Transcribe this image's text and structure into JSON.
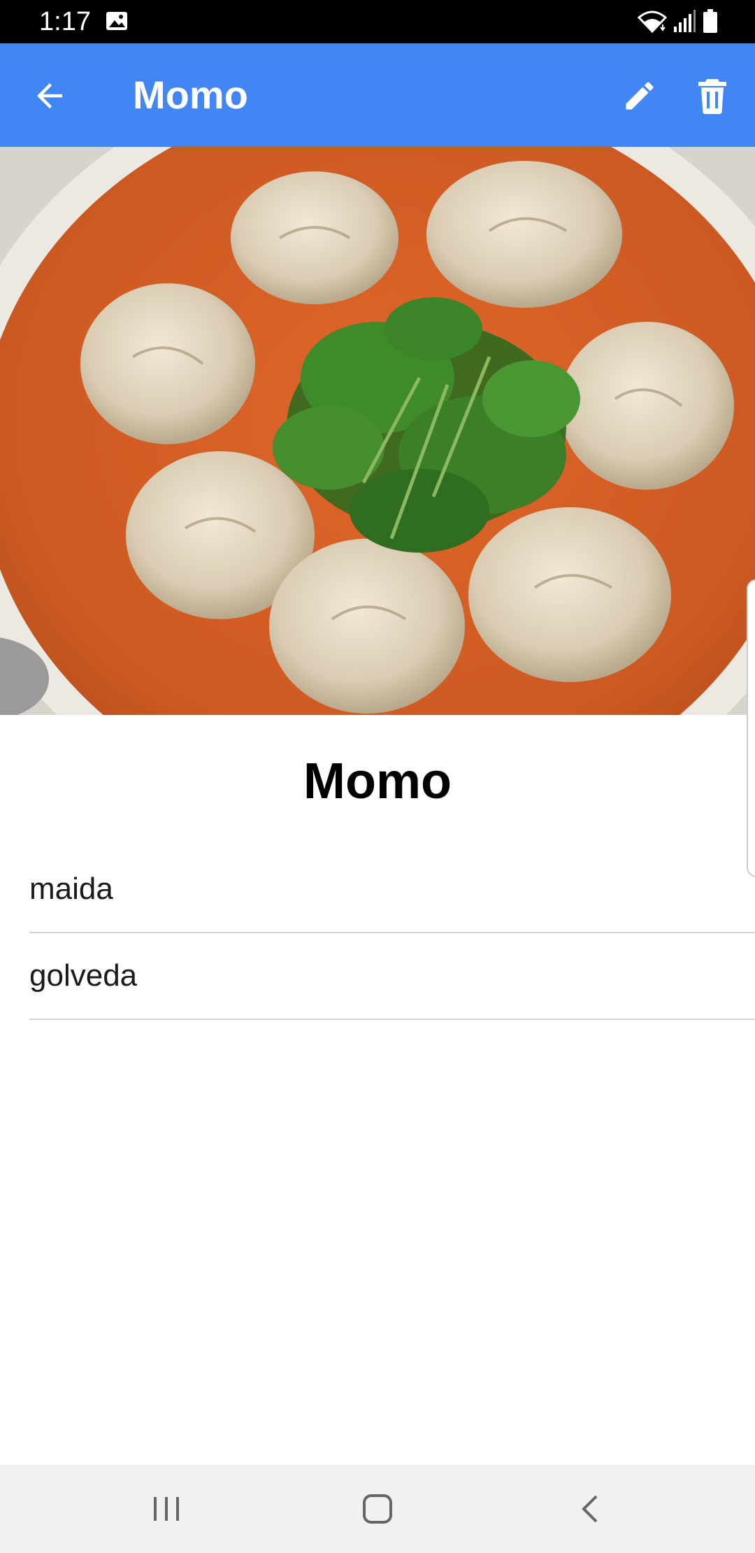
{
  "status_bar": {
    "time": "1:17",
    "icons": [
      "gallery-icon",
      "wifi-icon",
      "signal-icon",
      "battery-icon"
    ]
  },
  "app_bar": {
    "title": "Momo",
    "background_color": "#4285f4",
    "actions": [
      "edit-icon",
      "delete-icon"
    ],
    "back_icon": "arrow-back-icon"
  },
  "recipe": {
    "name": "Momo",
    "photo_subject": "momo-dumplings-photo",
    "ingredients": [
      "maida",
      "golveda"
    ]
  },
  "nav_bar": {
    "buttons": [
      "recents-icon",
      "home-icon",
      "back-icon"
    ]
  }
}
